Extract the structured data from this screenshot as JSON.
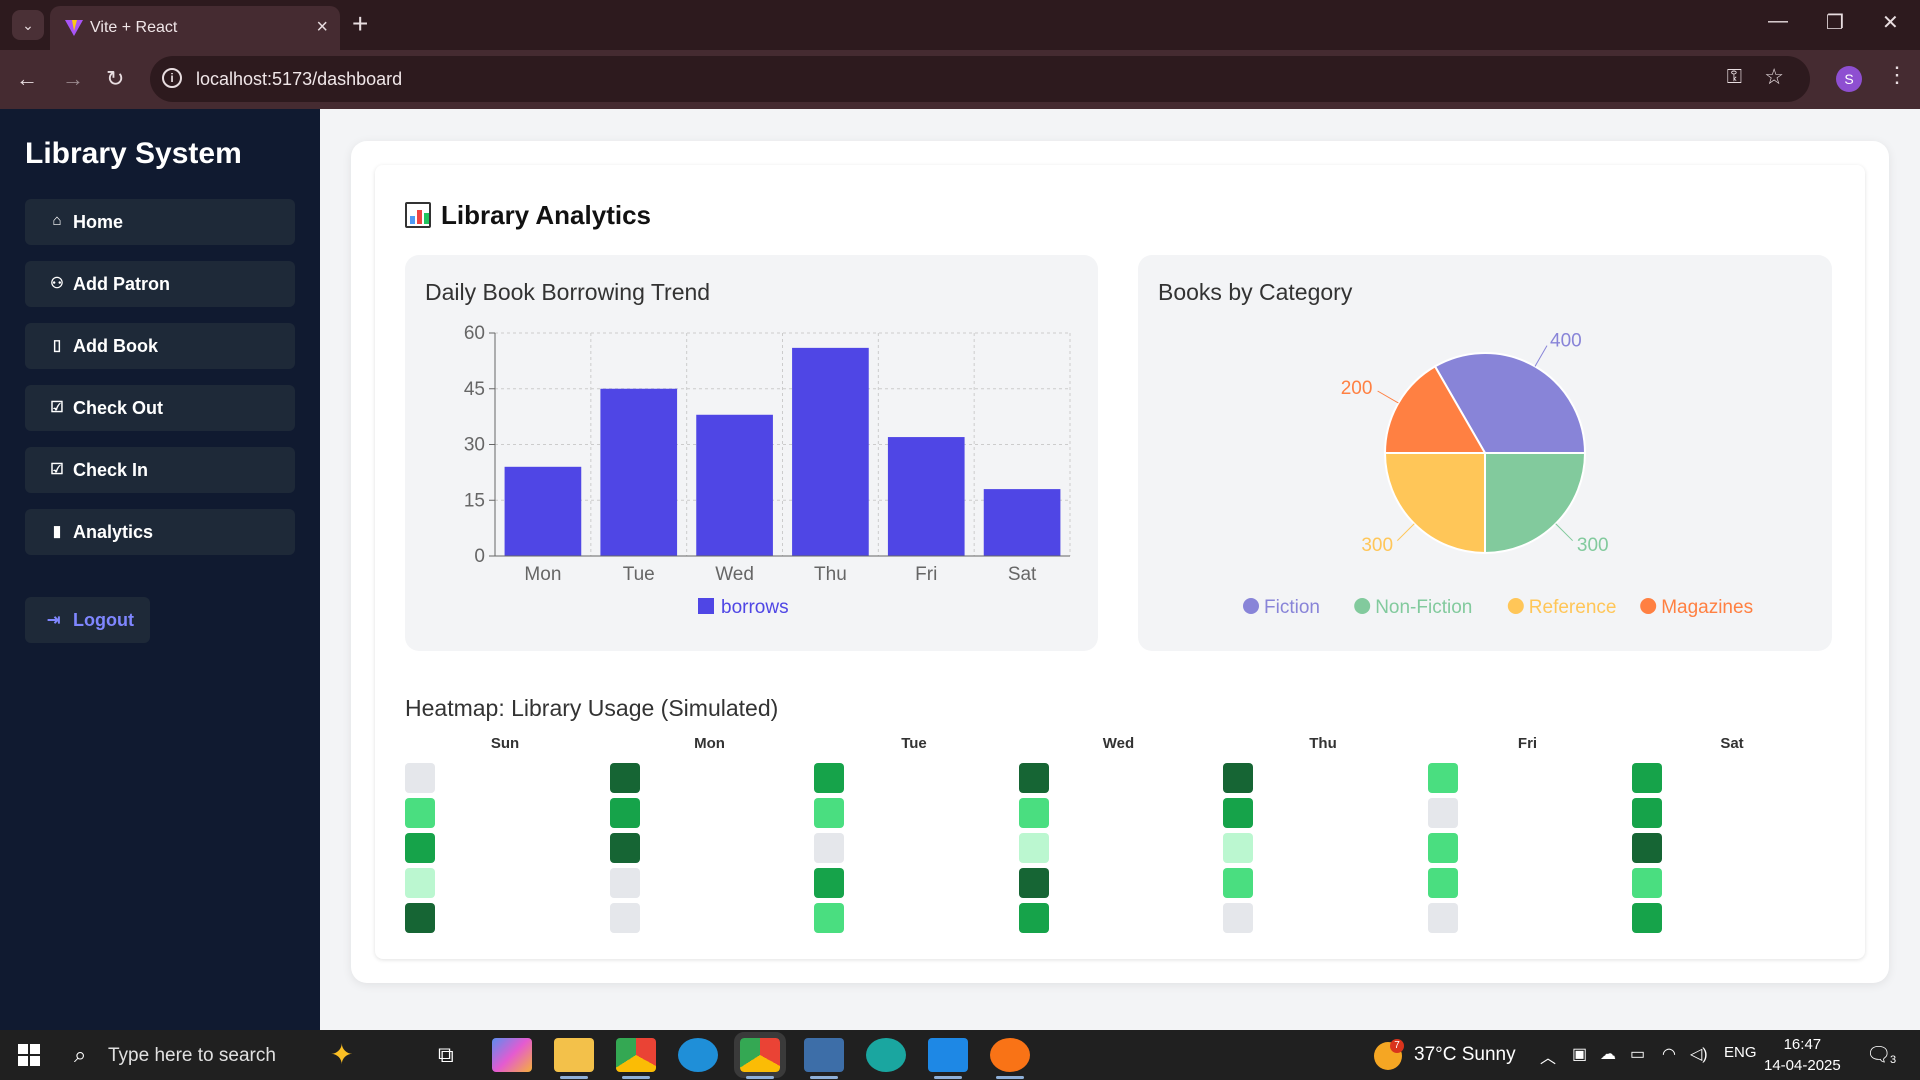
{
  "browser": {
    "tab_title": "Vite + React",
    "url": "localhost:5173/dashboard",
    "profile_initial": "S"
  },
  "sidebar": {
    "brand": "Library System",
    "items": [
      {
        "label": "Home",
        "icon": "home-icon"
      },
      {
        "label": "Add Patron",
        "icon": "users-icon"
      },
      {
        "label": "Add Book",
        "icon": "book-icon"
      },
      {
        "label": "Check Out",
        "icon": "check-square-icon"
      },
      {
        "label": "Check In",
        "icon": "check-square-icon"
      },
      {
        "label": "Analytics",
        "icon": "bar-chart-icon"
      }
    ],
    "logout": "Logout"
  },
  "page": {
    "title": "Library Analytics"
  },
  "bar_panel": {
    "title": "Daily Book Borrowing Trend"
  },
  "pie_panel": {
    "title": "Books by Category"
  },
  "chart_data": [
    {
      "type": "bar",
      "title": "Daily Book Borrowing Trend",
      "categories": [
        "Mon",
        "Tue",
        "Wed",
        "Thu",
        "Fri",
        "Sat"
      ],
      "series": [
        {
          "name": "borrows",
          "values": [
            24,
            45,
            38,
            56,
            32,
            18
          ],
          "color": "#4f46e5"
        }
      ],
      "y_ticks": [
        0,
        15,
        30,
        45,
        60
      ],
      "ylim": [
        0,
        60
      ],
      "grid": true,
      "legend": "bottom"
    },
    {
      "type": "pie",
      "title": "Books by Category",
      "slices": [
        {
          "name": "Fiction",
          "value": 400,
          "color": "#8884d8"
        },
        {
          "name": "Magazines",
          "value": 200,
          "color": "#ff8042"
        },
        {
          "name": "Reference",
          "value": 300,
          "color": "#ffc658"
        },
        {
          "name": "Non-Fiction",
          "value": 300,
          "color": "#82ca9d"
        }
      ],
      "legend_order": [
        "Fiction",
        "Non-Fiction",
        "Reference",
        "Magazines"
      ],
      "legend": "bottom"
    }
  ],
  "heatmap": {
    "title": "Heatmap: Library Usage (Simulated)",
    "days": [
      "Sun",
      "Mon",
      "Tue",
      "Wed",
      "Thu",
      "Fri",
      "Sat"
    ],
    "levels": [
      [
        0,
        2,
        3,
        1,
        4
      ],
      [
        4,
        3,
        4,
        0,
        0
      ],
      [
        3,
        2,
        0,
        3,
        2
      ],
      [
        4,
        2,
        1,
        4,
        3
      ],
      [
        4,
        3,
        1,
        2,
        0
      ],
      [
        2,
        0,
        2,
        2,
        0
      ],
      [
        3,
        3,
        4,
        2,
        3
      ]
    ],
    "level_colors": [
      "#e5e7eb",
      "#bbf7d0",
      "#4ade80",
      "#16a34a",
      "#166534"
    ]
  },
  "taskbar": {
    "search_placeholder": "Type here to search",
    "weather": "37°C  Sunny",
    "weather_badge": "7",
    "language": "ENG",
    "time": "16:47",
    "date": "14-04-2025",
    "notifications": "3"
  }
}
